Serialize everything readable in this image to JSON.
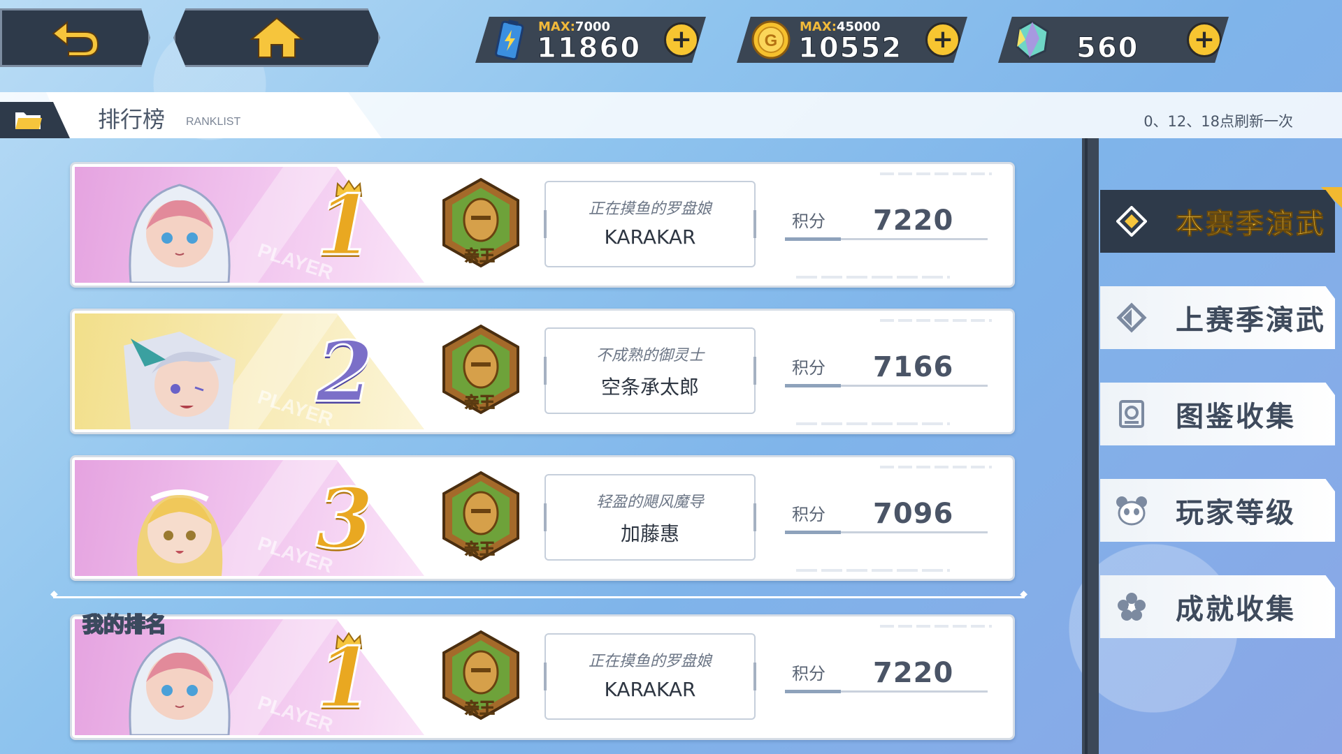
{
  "nav": {
    "back_icon": "back-arrow-icon",
    "home_icon": "home-icon"
  },
  "currencies": [
    {
      "icon": "energy-battery-icon",
      "max_label": "MAX:",
      "max_value": "7000",
      "value": "11860"
    },
    {
      "icon": "gold-coin-icon",
      "max_label": "MAX:",
      "max_value": "45000",
      "value": "10552"
    },
    {
      "icon": "crystal-gem-icon",
      "max_label": "",
      "max_value": "",
      "value": "560"
    }
  ],
  "plus_label": "+",
  "header": {
    "title": "排行榜",
    "subtitle": "RANKLIST",
    "refresh_note": "0、12、18点刷新一次"
  },
  "ranks": [
    {
      "rank": "1",
      "badge": "亲王",
      "title": "正在摸鱼的罗盘娘",
      "name": "KARAKAR",
      "score_label": "积分",
      "score": "7220",
      "stamp": "PLAYER"
    },
    {
      "rank": "2",
      "badge": "亲王",
      "title": "不成熟的御灵士",
      "name": "空条承太郎",
      "score_label": "积分",
      "score": "7166",
      "stamp": "PLAYER"
    },
    {
      "rank": "3",
      "badge": "亲王",
      "title": "轻盈的飓风魔导",
      "name": "加藤惠",
      "score_label": "积分",
      "score": "7096",
      "stamp": "PLAYER"
    }
  ],
  "my_rank": {
    "label": "我的排名",
    "rank": "1",
    "badge": "亲王",
    "title": "正在摸鱼的罗盘娘",
    "name": "KARAKAR",
    "score_label": "积分",
    "score": "7220",
    "stamp": "PLAYER"
  },
  "side_menu": [
    {
      "label": "本赛季演武",
      "icon": "season-target-icon",
      "active": true
    },
    {
      "label": "上赛季演武",
      "icon": "previous-season-icon",
      "active": false
    },
    {
      "label": "图鉴收集",
      "icon": "codex-icon",
      "active": false
    },
    {
      "label": "玩家等级",
      "icon": "panda-icon",
      "active": false
    },
    {
      "label": "成就收集",
      "icon": "flower-icon",
      "active": false
    }
  ],
  "colors": {
    "accent_gold": "#f6c53c",
    "panel_dark": "#2e3a4a",
    "rank_gold": "#e9a821",
    "rank_silver": "#7b6fc8"
  }
}
